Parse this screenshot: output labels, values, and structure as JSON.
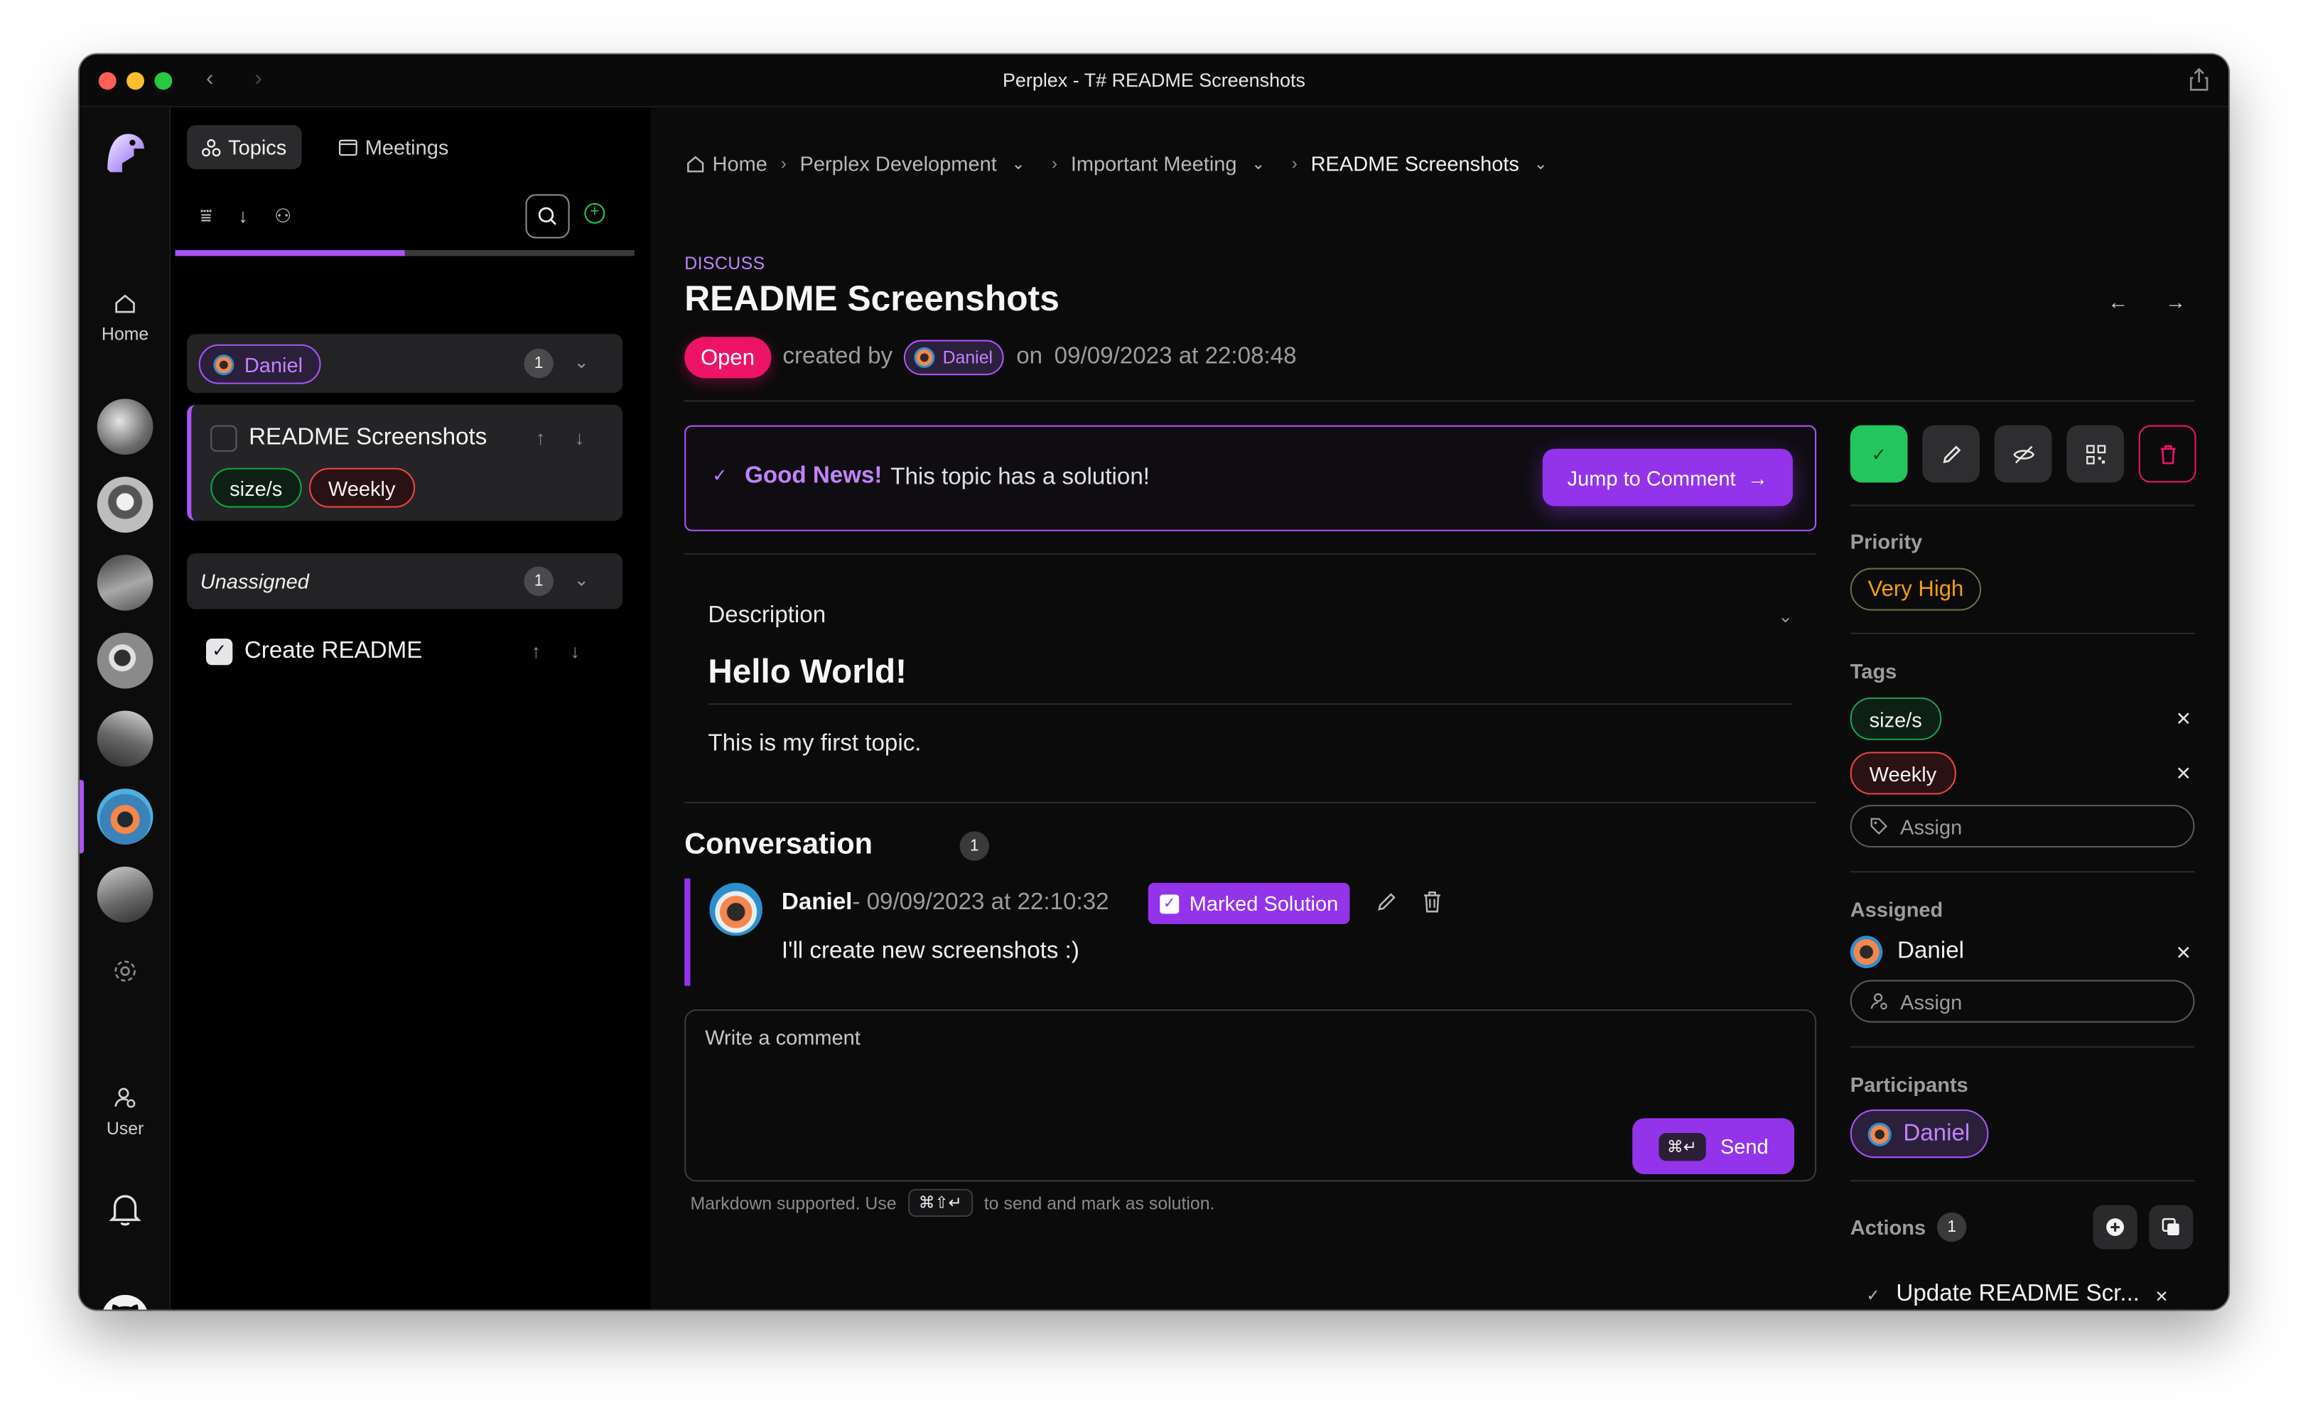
{
  "window": {
    "title": "Perplex - T# README Screenshots"
  },
  "rail": {
    "home_label": "Home",
    "user_label": "User"
  },
  "list": {
    "tabs": [
      {
        "label": "Topics"
      },
      {
        "label": "Meetings"
      }
    ],
    "progress_fraction": 0.5,
    "groups": [
      {
        "chip_label": "Daniel",
        "count": "1",
        "topics": [
          {
            "title": "README Screenshots",
            "tags": [
              "size/s",
              "Weekly"
            ],
            "done": false
          }
        ]
      },
      {
        "label": "Unassigned",
        "count": "1",
        "topics": [
          {
            "title": "Create README",
            "done": true
          }
        ]
      }
    ]
  },
  "breadcrumb": [
    "Home",
    "Perplex Development",
    "Important Meeting",
    "README Screenshots"
  ],
  "topic": {
    "kicker": "DISCUSS",
    "title": "README Screenshots",
    "status": "Open",
    "created_by_text": "created by",
    "creator": "Daniel",
    "on_text": "on",
    "created_at": "09/09/2023 at 22:08:48"
  },
  "solution": {
    "headline": "Good News!",
    "message": "This topic has a solution!",
    "jump_label": "Jump to Comment"
  },
  "description": {
    "label": "Description",
    "heading": "Hello World!",
    "body": "This is my first topic."
  },
  "conversation": {
    "title": "Conversation",
    "count": "1",
    "comments": [
      {
        "author": "Daniel",
        "date": "- 09/09/2023 at 22:10:32",
        "badge": "Marked Solution",
        "text": "I'll create new screenshots :)"
      }
    ]
  },
  "composer": {
    "placeholder": "Write a comment",
    "send_label": "Send",
    "send_shortcut": "⌘↵",
    "hint_prefix": "Markdown supported. Use",
    "hint_shortcut": "⌘⇧↵",
    "hint_suffix": "to send and mark as solution."
  },
  "sidebar": {
    "priority_label": "Priority",
    "priority_value": "Very High",
    "tags_label": "Tags",
    "tags": [
      "size/s",
      "Weekly"
    ],
    "tags_assign_placeholder": "Assign",
    "assigned_label": "Assigned",
    "assigned": "Daniel",
    "assigned_assign_placeholder": "Assign",
    "participants_label": "Participants",
    "participants": [
      "Daniel"
    ],
    "actions_label": "Actions",
    "actions_count": "1",
    "actions": [
      "Update README Scr..."
    ]
  },
  "colors": {
    "accent": "#a855f7",
    "accent_button": "#9333ea",
    "open_status": "#ec1467",
    "priority": "#f59e0b",
    "success": "#22c55e",
    "danger": "#ef4444"
  }
}
